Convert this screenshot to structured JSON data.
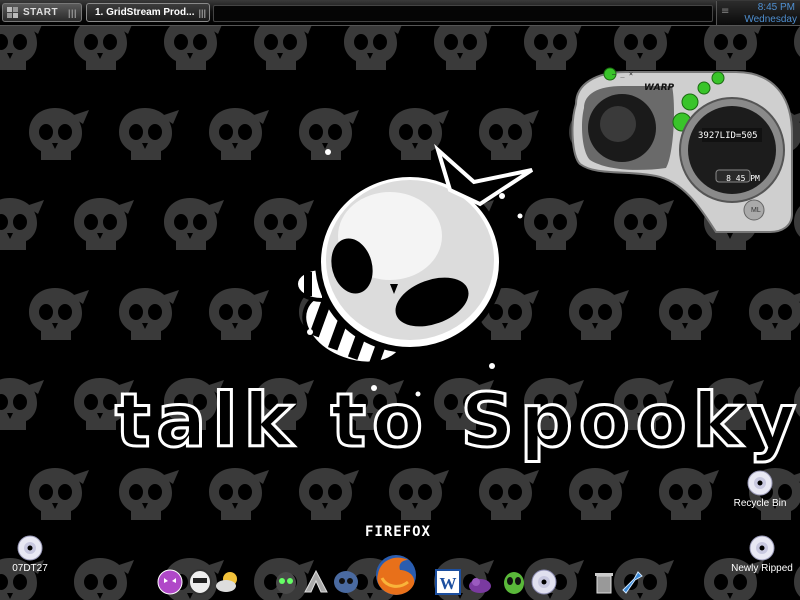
{
  "taskbar": {
    "start_label": "START",
    "task_label": "1. GridStream Prod...",
    "grip": "|||"
  },
  "tray": {
    "time": "8:45 PM",
    "day": "Wednesday",
    "grip": "≡"
  },
  "desktop": {
    "wallpaper_text": "talk to Spooky",
    "firefox_label": "FIREFOX",
    "icons": [
      {
        "label": "Recycle Bin",
        "icon": "cd-icon"
      },
      {
        "label": "07DT27",
        "icon": "cd-icon"
      },
      {
        "label": "Newly Ripped",
        "icon": "cd-icon"
      }
    ]
  },
  "player": {
    "brand": "WARP",
    "readout": "3927LID=505",
    "time": "8 45 PM",
    "minmax": "– _ ×",
    "ml": "ML"
  },
  "colors": {
    "background": "#000000",
    "skull_pattern": "#3d3d3d",
    "clock_text": "#4f8fd0",
    "player_green": "#39c42a"
  },
  "dock": [
    {
      "name": "purple-face-icon"
    },
    {
      "name": "mask-icon"
    },
    {
      "name": "weather-icon"
    },
    {
      "name": "alien-gir-icon"
    },
    {
      "name": "chevron-logo-icon"
    },
    {
      "name": "skull-blue-icon"
    },
    {
      "name": "firefox-icon"
    },
    {
      "name": "word-icon"
    },
    {
      "name": "purple-creature-icon"
    },
    {
      "name": "green-alien-icon"
    },
    {
      "name": "cd-icon"
    },
    {
      "name": "trash-icon"
    },
    {
      "name": "blue-tool-icon"
    }
  ]
}
